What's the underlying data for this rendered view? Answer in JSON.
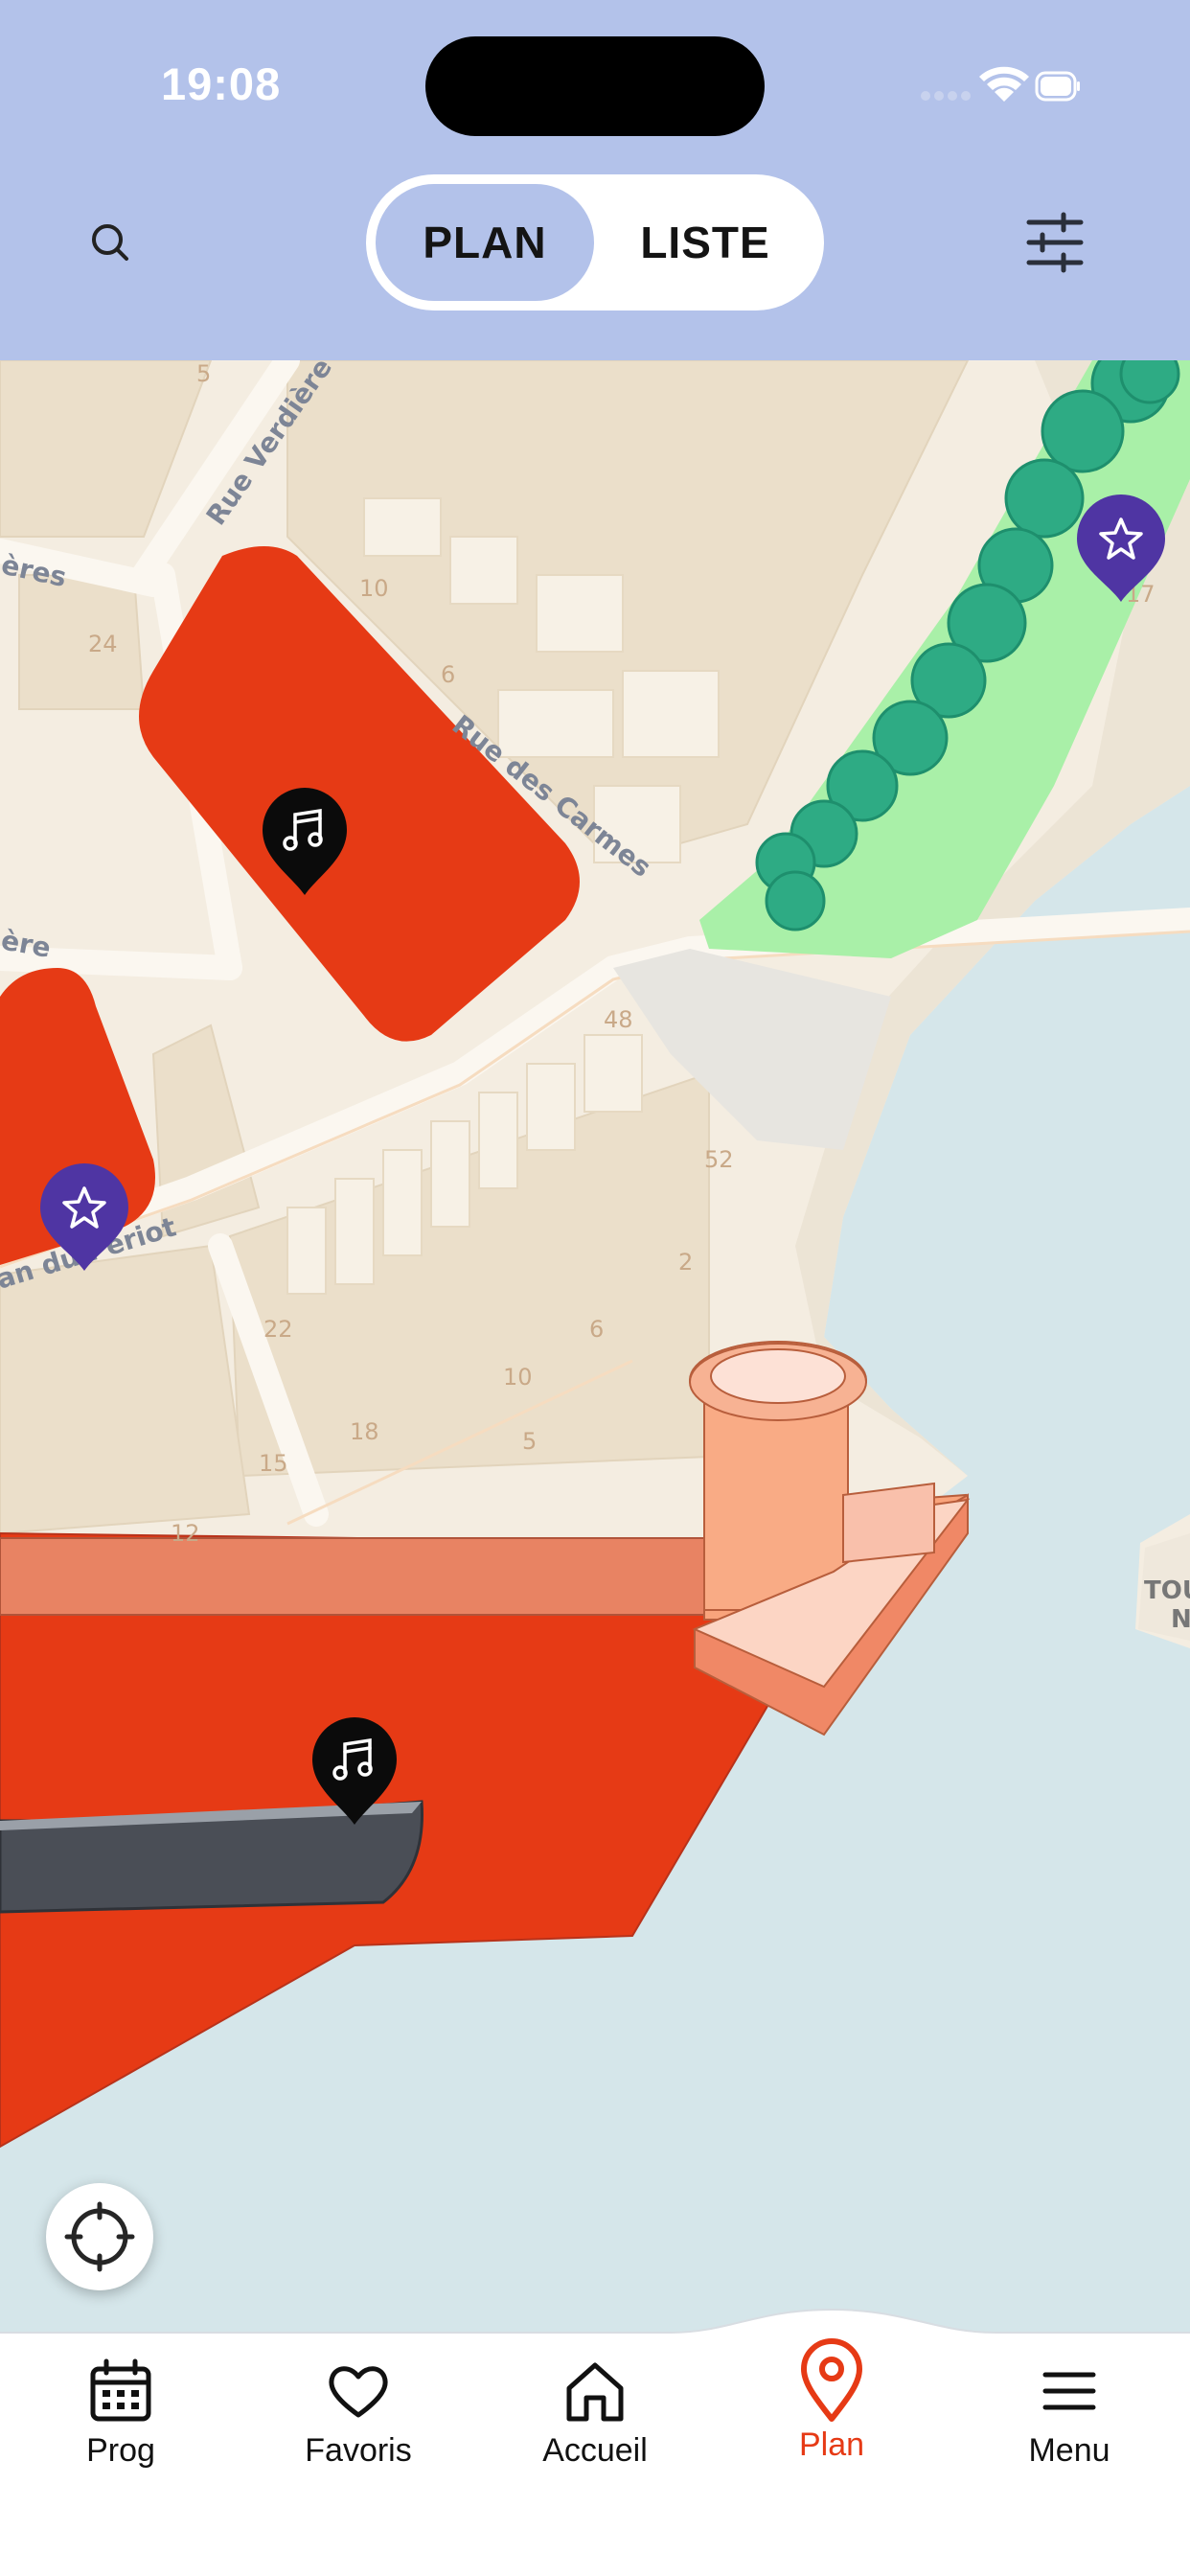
{
  "status_bar": {
    "time": "19:08"
  },
  "header": {
    "view_toggle": {
      "plan_label": "PLAN",
      "liste_label": "LISTE",
      "selected": "PLAN"
    }
  },
  "map": {
    "street_labels": [
      "Rue Verdière",
      "Rue des Carmes",
      "ères",
      "ère",
      "an du Périot"
    ],
    "numbers": [
      "5",
      "10",
      "6",
      "24",
      "17",
      "48",
      "52",
      "2",
      "6",
      "10",
      "22",
      "18",
      "15",
      "5",
      "12"
    ],
    "edge_label": [
      "TOU",
      "N"
    ]
  },
  "tabbar": {
    "items": [
      {
        "label": "Prog",
        "icon": "calendar-icon"
      },
      {
        "label": "Favoris",
        "icon": "heart-icon"
      },
      {
        "label": "Accueil",
        "icon": "home-icon"
      },
      {
        "label": "Plan",
        "icon": "map-pin-icon",
        "active": true
      },
      {
        "label": "Menu",
        "icon": "menu-icon"
      }
    ]
  },
  "colors": {
    "header_bg": "#b3c2ea",
    "accent_orange": "#e63a15",
    "water": "#d5e6ea",
    "land": "#f4ede1",
    "park": "#a9f0a8",
    "trees": "#2eab84",
    "pin_purple": "#4f35a3"
  }
}
